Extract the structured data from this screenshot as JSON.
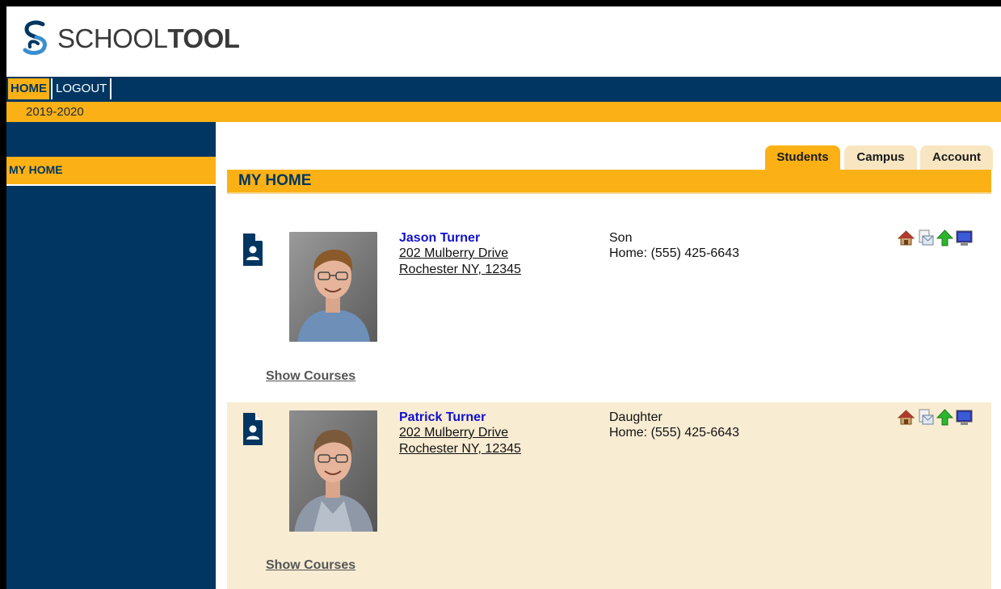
{
  "app": {
    "logo_text_light": "SCHOOL",
    "logo_text_bold": "TOOL"
  },
  "nav": {
    "home": "HOME",
    "logout": "LOGOUT"
  },
  "year": "2019-2020",
  "sidebar": {
    "items": [
      {
        "label": "MY HOME"
      }
    ]
  },
  "tabs": [
    {
      "label": "Students",
      "active": true
    },
    {
      "label": "Campus"
    },
    {
      "label": "Account"
    }
  ],
  "section": {
    "title": "MY HOME"
  },
  "students": [
    {
      "name": "Jason Turner",
      "address_line1": "202 Mulberry Drive",
      "address_line2": "Rochester NY, 12345",
      "relation": "Son",
      "phone": "Home: (555) 425-6643",
      "show_courses": "Show Courses",
      "icons": [
        "house-icon",
        "mail-icon",
        "green-arrow-up-icon",
        "computer-icon"
      ]
    },
    {
      "name": "Patrick Turner",
      "address_line1": "202 Mulberry Drive",
      "address_line2": "Rochester NY, 12345",
      "relation": "Daughter",
      "phone": "Home: (555) 425-6643",
      "show_courses": "Show Courses",
      "icons": [
        "house-icon",
        "mail-icon",
        "green-arrow-up-icon",
        "computer-icon"
      ]
    }
  ],
  "colors": {
    "navy": "#003661",
    "gold": "#fbb115",
    "row_alt": "#f8ecd3",
    "link_blue": "#1111cc"
  }
}
